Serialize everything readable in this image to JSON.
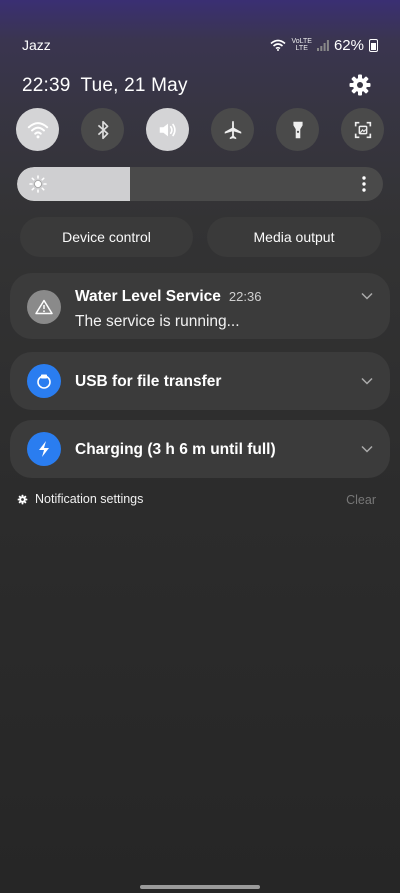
{
  "status_bar": {
    "carrier": "Jazz",
    "volte_label": "VoLTE",
    "lte_label": "LTE",
    "battery": "62%",
    "icons": [
      "wifi-icon",
      "signal-icon",
      "battery-icon"
    ]
  },
  "header": {
    "time": "22:39",
    "date": "Tue, 21 May",
    "settings_icon": "gear-icon"
  },
  "quick_settings": [
    {
      "name": "wifi",
      "icon": "wifi-icon",
      "active": true
    },
    {
      "name": "bluetooth",
      "icon": "bluetooth-icon",
      "active": false
    },
    {
      "name": "sound",
      "icon": "volume-icon",
      "active": true
    },
    {
      "name": "airplane-mode",
      "icon": "airplane-icon",
      "active": false
    },
    {
      "name": "flashlight",
      "icon": "flashlight-icon",
      "active": false
    },
    {
      "name": "screenshot",
      "icon": "screenshot-icon",
      "active": false
    }
  ],
  "brightness": {
    "level": 0.31,
    "icon": "sun-icon",
    "menu_icon": "more-vertical-icon"
  },
  "controls": {
    "device_control": "Device control",
    "media_output": "Media output"
  },
  "notifications": [
    {
      "id": "water",
      "icon": "warning-icon",
      "title": "Water Level Service",
      "time": "22:36",
      "body": "The service is running..."
    },
    {
      "id": "usb",
      "icon": "usb-icon",
      "title": "USB for file transfer"
    },
    {
      "id": "charging",
      "icon": "lightning-icon",
      "title": "Charging (3 h 6 m until full)"
    }
  ],
  "footer": {
    "notification_settings": "Notification settings",
    "clear": "Clear"
  },
  "colors": {
    "accent": "#2a7df0",
    "tile_on": "#d4d4d6",
    "tile_off": "#4a4a4a",
    "card": "#3b3b3b"
  }
}
